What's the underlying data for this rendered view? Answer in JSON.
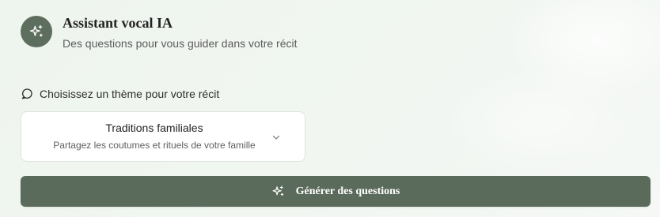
{
  "assistant": {
    "icon": "sparkles-icon",
    "title": "Assistant vocal IA",
    "subtitle": "Des questions pour vous guider dans votre récit"
  },
  "theme": {
    "icon": "chat-bubble-icon",
    "label": "Choisissez un thème pour votre récit",
    "selected": {
      "title": "Traditions familiales",
      "description": "Partagez les coutumes et rituels de votre famille"
    },
    "chevron_icon": "chevron-down-icon"
  },
  "generate_button": {
    "icon": "sparkles-icon",
    "label": "Générer des questions"
  },
  "colors": {
    "accent": "#5b6b5b",
    "background": "#eef4ee"
  }
}
